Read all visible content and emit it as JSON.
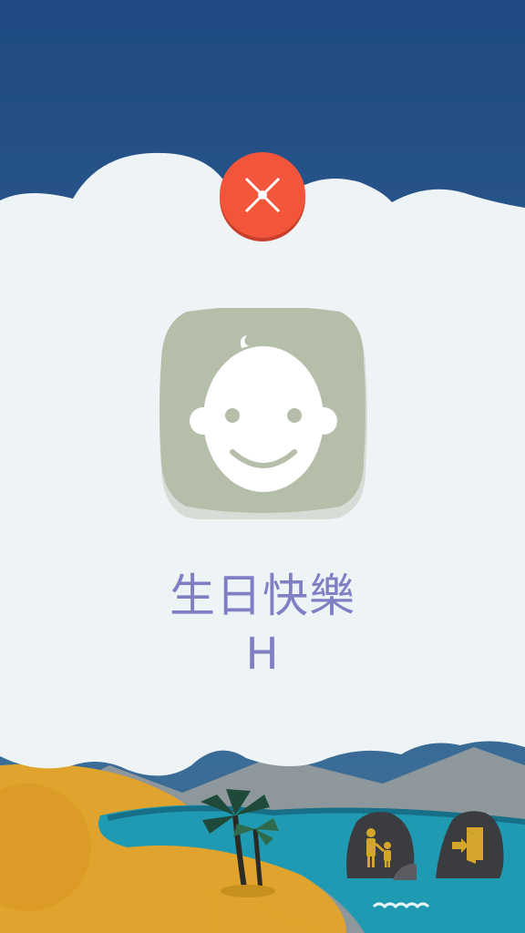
{
  "dialog": {
    "title": "生日快樂",
    "name": "H"
  },
  "icons": {
    "close": "close-x-icon",
    "avatar": "baby-face-icon",
    "parent": "parent-child-icon",
    "exit": "exit-door-icon"
  },
  "colors": {
    "sky_top": "#1f4a83",
    "sky_bottom": "#3f739a",
    "cloud": "#eef3f5",
    "close_button": "#f2553a",
    "avatar_tile": "#b5bea9",
    "text": "#7f7fc4",
    "sand": "#e0a32d",
    "water": "#1f9ab2",
    "rock": "#3b3c3f",
    "icon_gold": "#d4a72c"
  }
}
